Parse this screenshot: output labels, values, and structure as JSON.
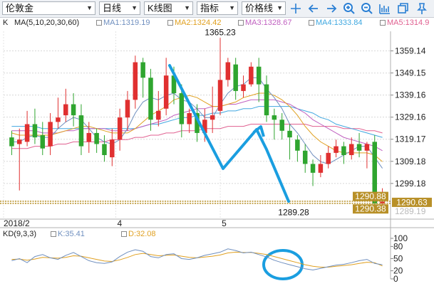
{
  "toolbar": {
    "symbol": "伦敦金",
    "period": "日线",
    "chart_type": "K线图",
    "indicator": "指标",
    "price_line": "价格线"
  },
  "legend": {
    "k": "K",
    "ma": "MA(5,10,20,30,60)",
    "ma1": "MA1:1319.19",
    "ma2": "MA2:1324.42",
    "ma3": "MA3:1328.67",
    "ma4": "MA4:1333.84",
    "ma5": "MA5:1314.9"
  },
  "colors": {
    "up": "#e03030",
    "down": "#2fa52f",
    "ma1": "#6f8fbf",
    "ma2": "#e0a020",
    "ma3": "#c060c0",
    "ma4": "#40a8e0",
    "ma5": "#e06090",
    "annotation": "#1a9ee0",
    "price_badge": "#b89028"
  },
  "price_axis": [
    "1359.14",
    "1349.15",
    "1339.16",
    "1329.16",
    "1319.17",
    "1309.18",
    "1299.18"
  ],
  "badges": {
    "left_top": "1290.88",
    "left_bottom": "1290.38",
    "right": "1290.63"
  },
  "labels": {
    "high": "1365.23",
    "low": "1289.28",
    "partial_tick": "1289.19"
  },
  "date_axis": [
    "2018/2",
    "4",
    "5"
  ],
  "kd": {
    "title": "KD(9,3,3)",
    "k": "K:35.41",
    "d": "D:32.08",
    "axis": [
      "100",
      "80",
      "50",
      "20",
      "0"
    ]
  },
  "chart_data": {
    "type": "candlestick",
    "ylim": [
      1284,
      1368
    ],
    "candles": [
      [
        1320,
        1316,
        1323,
        1312
      ],
      [
        1317,
        1319,
        1324,
        1296
      ],
      [
        1318,
        1326,
        1332,
        1316
      ],
      [
        1326,
        1320,
        1333,
        1317
      ],
      [
        1321,
        1315,
        1327,
        1312
      ],
      [
        1316,
        1327,
        1331,
        1312
      ],
      [
        1327,
        1329,
        1338,
        1324
      ],
      [
        1330,
        1335,
        1342,
        1327
      ],
      [
        1335,
        1330,
        1340,
        1325
      ],
      [
        1330,
        1316,
        1335,
        1312
      ],
      [
        1318,
        1322,
        1327,
        1313
      ],
      [
        1322,
        1317,
        1324,
        1313
      ],
      [
        1317,
        1312,
        1321,
        1309
      ],
      [
        1311,
        1319,
        1324,
        1307
      ],
      [
        1319,
        1329,
        1333,
        1314
      ],
      [
        1329,
        1337,
        1341,
        1323
      ],
      [
        1337,
        1354,
        1357,
        1333
      ],
      [
        1354,
        1347,
        1356,
        1338
      ],
      [
        1347,
        1328,
        1351,
        1323
      ],
      [
        1328,
        1332,
        1341,
        1325
      ],
      [
        1333,
        1348,
        1356,
        1330
      ],
      [
        1348,
        1340,
        1352,
        1335
      ],
      [
        1340,
        1326,
        1344,
        1320
      ],
      [
        1326,
        1331,
        1333,
        1322
      ],
      [
        1331,
        1322,
        1335,
        1318
      ],
      [
        1322,
        1328,
        1333,
        1318
      ],
      [
        1328,
        1330,
        1343,
        1322
      ],
      [
        1332,
        1346,
        1365,
        1330
      ],
      [
        1346,
        1354,
        1356,
        1343
      ],
      [
        1353,
        1341,
        1356,
        1337
      ],
      [
        1341,
        1344,
        1348,
        1338
      ],
      [
        1344,
        1352,
        1354,
        1343
      ],
      [
        1352,
        1344,
        1356,
        1336
      ],
      [
        1344,
        1330,
        1348,
        1327
      ],
      [
        1330,
        1328,
        1333,
        1319
      ],
      [
        1328,
        1323,
        1331,
        1319
      ],
      [
        1323,
        1320,
        1326,
        1310
      ],
      [
        1319,
        1314,
        1321,
        1309
      ],
      [
        1314,
        1308,
        1317,
        1304
      ],
      [
        1308,
        1304,
        1310,
        1298
      ],
      [
        1304,
        1308,
        1312,
        1302
      ],
      [
        1308,
        1313,
        1316,
        1306
      ],
      [
        1313,
        1316,
        1319,
        1311
      ],
      [
        1316,
        1312,
        1318,
        1308
      ],
      [
        1312,
        1317,
        1320,
        1310
      ],
      [
        1317,
        1314,
        1322,
        1311
      ],
      [
        1314,
        1317,
        1318,
        1306
      ],
      [
        1318,
        1290,
        1321,
        1289
      ],
      [
        1290,
        1291,
        1297,
        1289
      ]
    ],
    "ma": {
      "ma1": [
        1318,
        1318,
        1320,
        1321,
        1320,
        1320,
        1324,
        1327,
        1329,
        1328,
        1324,
        1320,
        1318,
        1317,
        1319,
        1324,
        1331,
        1336,
        1338,
        1337,
        1339,
        1340,
        1337,
        1336,
        1333,
        1329,
        1329,
        1335,
        1340,
        1343,
        1344,
        1347,
        1347,
        1342,
        1338,
        1333,
        1326,
        1322,
        1317,
        1312,
        1309,
        1308,
        1310,
        1312,
        1314,
        1316,
        1316,
        1311,
        1306
      ],
      "ma2": [
        1322,
        1321,
        1321,
        1321,
        1321,
        1321,
        1322,
        1323,
        1324,
        1325,
        1325,
        1324,
        1323,
        1322,
        1322,
        1322,
        1324,
        1327,
        1330,
        1332,
        1334,
        1337,
        1338,
        1339,
        1338,
        1336,
        1334,
        1334,
        1335,
        1336,
        1338,
        1339,
        1340,
        1340,
        1339,
        1337,
        1334,
        1330,
        1325,
        1321,
        1318,
        1316,
        1314,
        1313,
        1313,
        1313,
        1313,
        1312,
        1309
      ],
      "ma3": [
        1323,
        1323,
        1323,
        1323,
        1322,
        1322,
        1322,
        1323,
        1323,
        1324,
        1324,
        1324,
        1324,
        1323,
        1323,
        1323,
        1324,
        1325,
        1326,
        1327,
        1328,
        1330,
        1331,
        1332,
        1333,
        1333,
        1334,
        1334,
        1335,
        1335,
        1336,
        1337,
        1337,
        1337,
        1337,
        1336,
        1335,
        1333,
        1331,
        1328,
        1326,
        1324,
        1322,
        1320,
        1319,
        1318,
        1317,
        1316,
        1314
      ],
      "ma4": [
        1325,
        1325,
        1325,
        1325,
        1324,
        1324,
        1324,
        1324,
        1324,
        1324,
        1324,
        1324,
        1324,
        1324,
        1324,
        1324,
        1324,
        1325,
        1326,
        1326,
        1327,
        1328,
        1329,
        1329,
        1330,
        1330,
        1331,
        1331,
        1332,
        1332,
        1333,
        1333,
        1334,
        1334,
        1334,
        1334,
        1334,
        1333,
        1332,
        1331,
        1329,
        1328,
        1326,
        1325,
        1324,
        1323,
        1322,
        1321,
        1320
      ],
      "ma5": [
        1315,
        1315,
        1315,
        1316,
        1316,
        1316,
        1317,
        1317,
        1318,
        1318,
        1318,
        1318,
        1318,
        1319,
        1319,
        1319,
        1320,
        1320,
        1321,
        1321,
        1322,
        1322,
        1323,
        1323,
        1323,
        1324,
        1324,
        1324,
        1325,
        1325,
        1325,
        1326,
        1326,
        1326,
        1326,
        1326,
        1326,
        1326,
        1326,
        1325,
        1325,
        1325,
        1325,
        1324,
        1324,
        1324,
        1323,
        1323,
        1322
      ]
    },
    "kd_k": [
      45,
      50,
      40,
      55,
      60,
      52,
      48,
      58,
      65,
      55,
      45,
      40,
      38,
      42,
      55,
      66,
      72,
      68,
      55,
      52,
      60,
      62,
      50,
      48,
      52,
      58,
      62,
      66,
      74,
      70,
      64,
      66,
      60,
      54,
      46,
      40,
      35,
      30,
      25,
      22,
      26,
      30,
      34,
      36,
      40,
      45,
      48,
      38,
      35
    ],
    "kd_d": [
      48,
      49,
      46,
      49,
      53,
      52,
      51,
      53,
      57,
      56,
      52,
      48,
      44,
      43,
      47,
      53,
      60,
      63,
      60,
      57,
      58,
      59,
      56,
      53,
      52,
      54,
      56,
      59,
      64,
      66,
      65,
      65,
      63,
      60,
      55,
      50,
      45,
      40,
      35,
      31,
      29,
      29,
      31,
      33,
      35,
      38,
      41,
      40,
      32
    ]
  }
}
